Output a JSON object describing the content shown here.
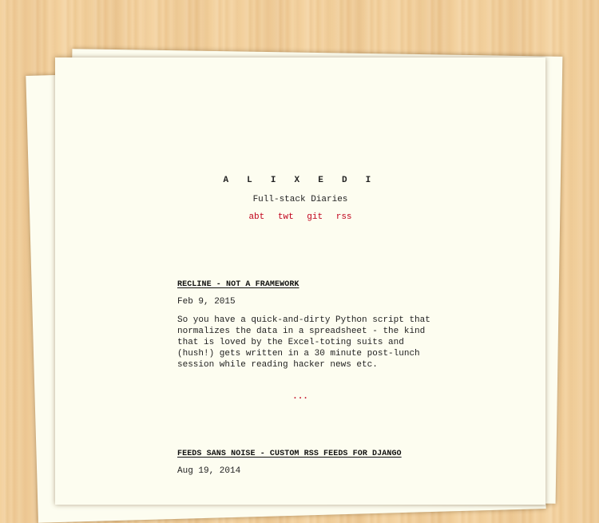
{
  "header": {
    "title": "A L I X E D I",
    "subtitle": "Full-stack Diaries",
    "nav": [
      {
        "label": "abt"
      },
      {
        "label": "twt"
      },
      {
        "label": "git"
      },
      {
        "label": "rss"
      }
    ]
  },
  "posts": [
    {
      "title": "RECLINE - NOT A FRAMEWORK",
      "date": "Feb 9, 2015",
      "excerpt_lines": [
        "So you have a quick-and-dirty Python script that",
        "normalizes the data in a spreadsheet - the kind",
        "that is loved by the Excel-toting suits and",
        "(hush!) gets written in a 30 minute post-lunch",
        "session while reading hacker news etc."
      ],
      "more_label": "..."
    },
    {
      "title": "FEEDS SANS NOISE - CUSTOM RSS FEEDS FOR DJANGO",
      "date": "Aug 19, 2014"
    }
  ],
  "colors": {
    "link": "#c0001a",
    "paper": "#fdfdf0",
    "wood": "#f3d19e"
  }
}
